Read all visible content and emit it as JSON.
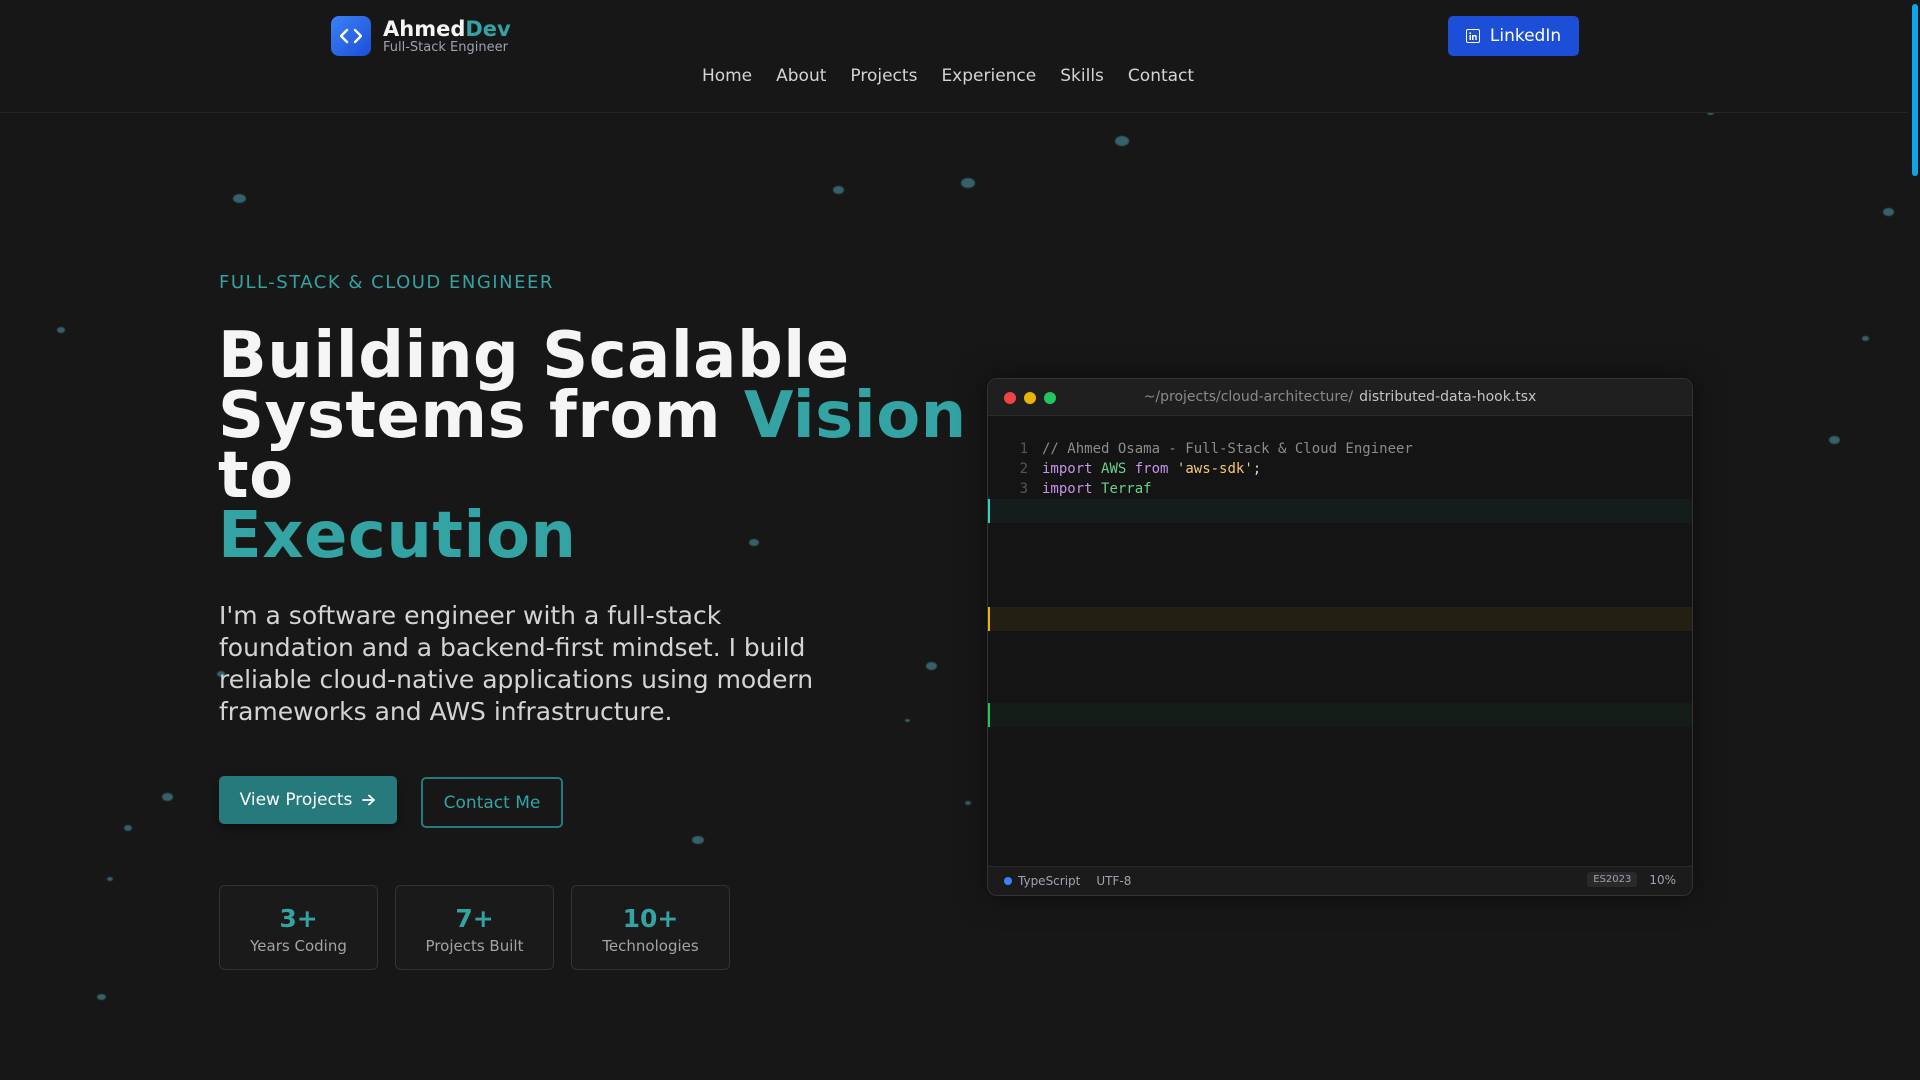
{
  "brand": {
    "name_main": "Ahmed",
    "name_accent": "Dev",
    "subtitle": "Full-Stack Engineer"
  },
  "nav": {
    "items": [
      "Home",
      "About",
      "Projects",
      "Experience",
      "Skills",
      "Contact"
    ]
  },
  "header": {
    "linkedin_label": "LinkedIn"
  },
  "hero": {
    "eyebrow": "FULL-STACK & CLOUD ENGINEER",
    "headline_1": "Building Scalable",
    "headline_2": "Systems from ",
    "headline_accent_1": "Vision",
    "headline_3": "to",
    "headline_accent_2": "Execution",
    "lead": "I'm a software engineer with a full-stack foundation and a backend-first mindset. I build reliable cloud-native applications using modern frameworks and AWS infrastructure.",
    "primary_button": "View Projects",
    "secondary_button": "Contact Me"
  },
  "stats": [
    {
      "value": "3+",
      "label": "Years Coding"
    },
    {
      "value": "7+",
      "label": "Projects Built"
    },
    {
      "value": "10+",
      "label": "Technologies"
    }
  ],
  "code_window": {
    "path": "~/projects/cloud-architecture/",
    "filename": "distributed-data-hook.tsx",
    "lines": [
      {
        "num": "1",
        "comment": "// Ahmed Osama - Full-Stack & Cloud Engineer"
      },
      {
        "num": "2",
        "kw": "import",
        "id": "AWS",
        "kw2": "from",
        "str": "'aws-sdk'",
        "tail": ";"
      },
      {
        "num": "3",
        "kw": "import",
        "id": "Terraf"
      }
    ],
    "status": {
      "language": "TypeScript",
      "encoding": "UTF-8",
      "target": "ES2023",
      "progress": "10%"
    },
    "highlight_colors": [
      "#2dd4bf",
      "#eab308",
      "#22c55e"
    ]
  },
  "colors": {
    "accent": "#33a3a3",
    "brand_blue": "#1d4ed8",
    "background": "#171717"
  }
}
